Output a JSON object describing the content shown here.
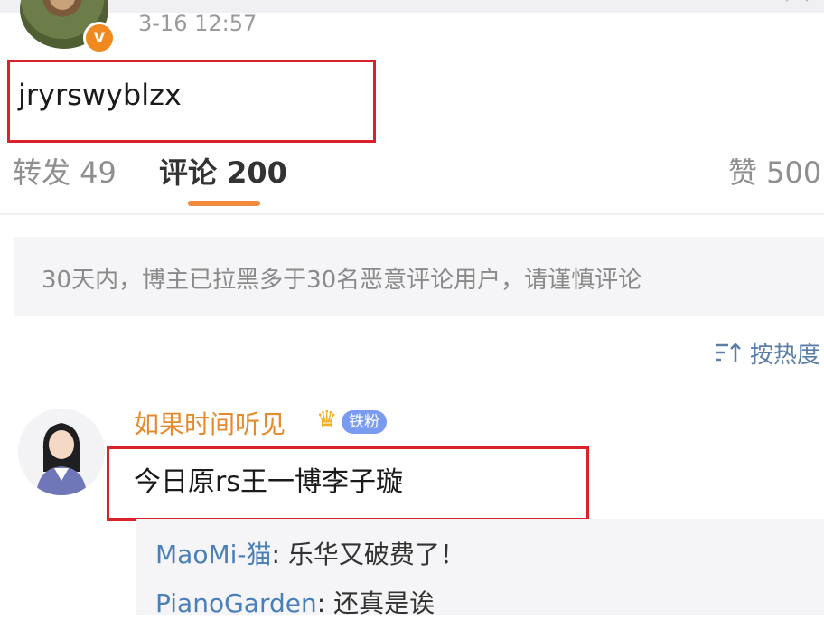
{
  "post": {
    "time": "3-16 12:57",
    "vip_badge": "V",
    "text": "jryrswyblzx"
  },
  "tabs": {
    "repost": "转发 49",
    "comments": "评论 200",
    "likes": "赞 500"
  },
  "notice": "30天内，博主已拉黑多于30名恶意评论用户，请谨慎评论",
  "sort": {
    "label": "按热度",
    "icon": "sort-icon"
  },
  "comment": {
    "user": "如果时间听见",
    "badge": "铁粉",
    "crown_icon": "crown-icon",
    "text": "今日原rs王一博李子璇"
  },
  "replies": [
    {
      "user": "MaoMi-猫",
      "text": "乐华又破费了！"
    },
    {
      "user": "PianoGarden",
      "text": "还真是诶"
    }
  ],
  "colors": {
    "accent_orange": "#f08a3c",
    "username_orange": "#e68a2e",
    "link_blue": "#4a7fb8",
    "highlight_red": "#d9222a"
  }
}
